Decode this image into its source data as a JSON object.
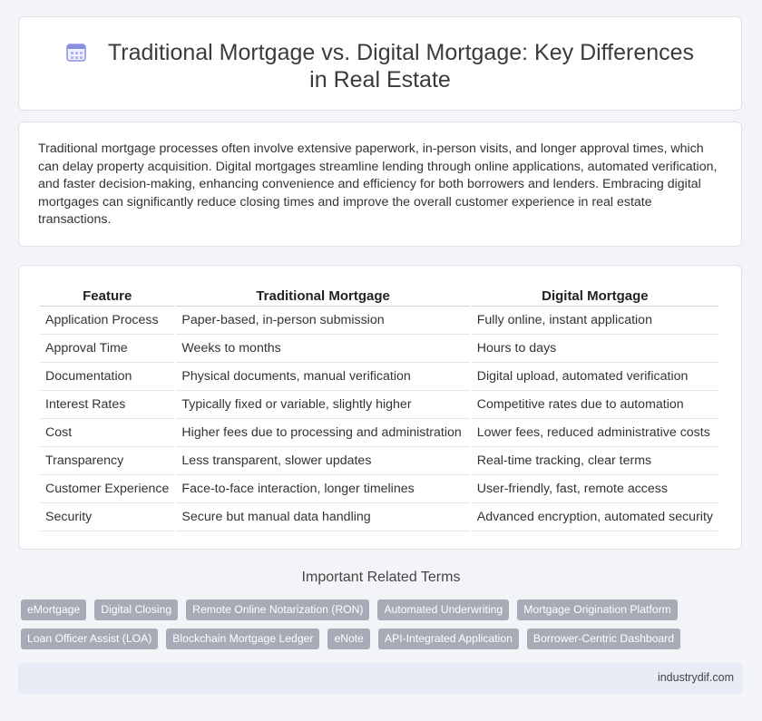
{
  "header": {
    "title": "Traditional Mortgage vs. Digital Mortgage: Key Differences in Real Estate",
    "icon": "calendar-icon",
    "icon_color": "#7b7fd6"
  },
  "intro": {
    "text": "Traditional mortgage processes often involve extensive paperwork, in-person visits, and longer approval times, which can delay property acquisition. Digital mortgages streamline lending through online applications, automated verification, and faster decision-making, enhancing convenience and efficiency for both borrowers and lenders. Embracing digital mortgages can significantly reduce closing times and improve the overall customer experience in real estate transactions."
  },
  "table": {
    "headers": [
      "Feature",
      "Traditional Mortgage",
      "Digital Mortgage"
    ],
    "rows": [
      [
        "Application Process",
        "Paper-based, in-person submission",
        "Fully online, instant application"
      ],
      [
        "Approval Time",
        "Weeks to months",
        "Hours to days"
      ],
      [
        "Documentation",
        "Physical documents, manual verification",
        "Digital upload, automated verification"
      ],
      [
        "Interest Rates",
        "Typically fixed or variable, slightly higher",
        "Competitive rates due to automation"
      ],
      [
        "Cost",
        "Higher fees due to processing and administration",
        "Lower fees, reduced administrative costs"
      ],
      [
        "Transparency",
        "Less transparent, slower updates",
        "Real-time tracking, clear terms"
      ],
      [
        "Customer Experience",
        "Face-to-face interaction, longer timelines",
        "User-friendly, fast, remote access"
      ],
      [
        "Security",
        "Secure but manual data handling",
        "Advanced encryption, automated security"
      ]
    ]
  },
  "related": {
    "title": "Important Related Terms",
    "row1": [
      "eMortgage",
      "Digital Closing",
      "Remote Online Notarization (RON)",
      "Automated Underwriting",
      "Mortgage Origination Platform"
    ],
    "row2": [
      "Loan Officer Assist (LOA)",
      "Blockchain Mortgage Ledger",
      "eNote",
      "API-Integrated Application",
      "Borrower-Centric Dashboard"
    ]
  },
  "footer": {
    "site": "industrydif.com"
  }
}
